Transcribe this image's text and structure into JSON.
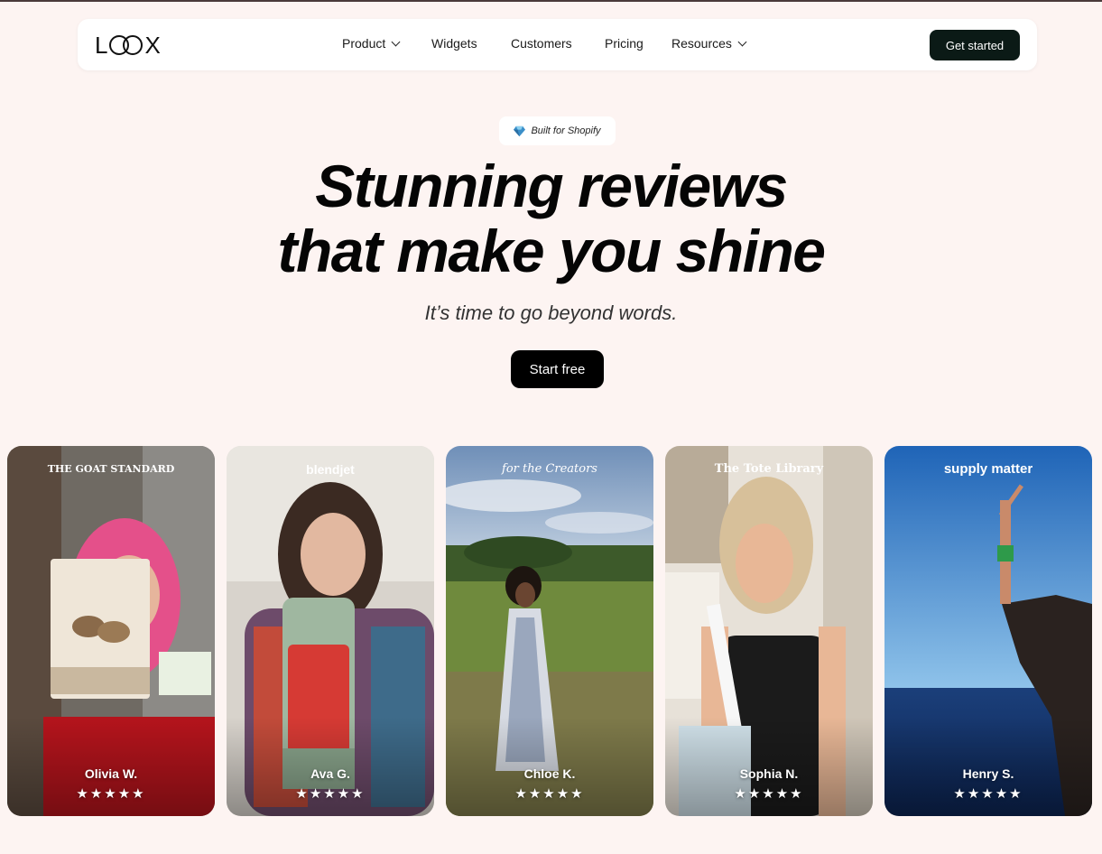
{
  "nav": {
    "logo": "LOOX",
    "links": [
      {
        "label": "Product",
        "has_dropdown": true
      },
      {
        "label": "Widgets",
        "has_dropdown": false
      },
      {
        "label": "Customers",
        "has_dropdown": false
      },
      {
        "label": "Pricing",
        "has_dropdown": false
      },
      {
        "label": "Resources",
        "has_dropdown": true
      }
    ],
    "cta": "Get started"
  },
  "hero": {
    "badge": "Built for Shopify",
    "headline_line1": "Stunning reviews",
    "headline_line2": "that make you shine",
    "subheadline": "It’s time to go beyond words.",
    "cta": "Start free"
  },
  "reviews": [
    {
      "brand": "THE GOAT STANDARD",
      "reviewer": "Olivia W.",
      "rating": 5
    },
    {
      "brand": "blendjet",
      "reviewer": "Ava G.",
      "rating": 5
    },
    {
      "brand": "for the Creators",
      "reviewer": "Chloe K.",
      "rating": 5
    },
    {
      "brand": "The Tote Library",
      "reviewer": "Sophia N.",
      "rating": 5
    },
    {
      "brand": "supply matter",
      "reviewer": "Henry S.",
      "rating": 5
    }
  ],
  "stars_text": "★★★★★",
  "colors": {
    "page_bg": "#fdf4f2",
    "nav_cta_bg": "#0b1a16",
    "hero_cta_bg": "#000000"
  }
}
